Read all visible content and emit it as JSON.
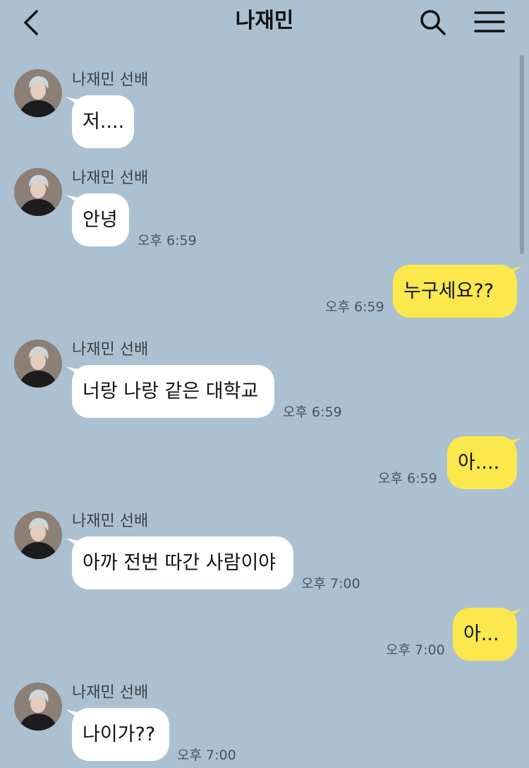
{
  "header": {
    "title": "나재민"
  },
  "contact": {
    "name": "나재민 선배"
  },
  "messages": [
    {
      "text": "저....",
      "time": ""
    },
    {
      "text": "안녕",
      "time": "오후 6:59"
    },
    {
      "text": "누구세요??",
      "time": "오후 6:59"
    },
    {
      "text": "너랑 나랑 같은 대학교",
      "time": "오후 6:59"
    },
    {
      "text": "아....",
      "time": "오후 6:59"
    },
    {
      "text": "아까 전번 따간 사람이야",
      "time": "오후 7:00"
    },
    {
      "text": "아...",
      "time": "오후 7:00"
    },
    {
      "text": "나이가??",
      "time": "오후 7:00"
    }
  ],
  "colors": {
    "background": "#abc1d1",
    "incoming_bubble": "#ffffff",
    "outgoing_bubble": "#fae84c"
  },
  "icons": {
    "back": "chevron-left-icon",
    "search": "search-icon",
    "menu": "hamburger-menu-icon"
  }
}
